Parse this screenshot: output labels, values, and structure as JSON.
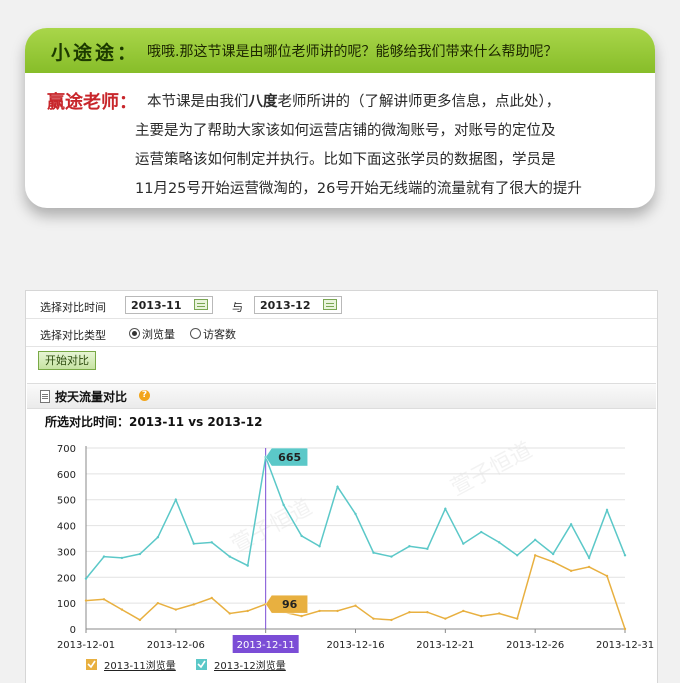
{
  "dialog": {
    "q_name": "小途途：",
    "q_text": "哦哦.那这节课是由哪位老师讲的呢？能够给我们带来什么帮助呢？",
    "a_name": "赢途老师：",
    "a_line1_pre": "本节课是由我们",
    "a_line1_bold": "八度",
    "a_line1_post": "老师所讲的（了解讲师更多信息，点此处），",
    "a_line2": "主要是为了帮助大家该如何运营店铺的微淘账号，对账号的定位及",
    "a_line3": "运营策略该如何制定并执行。比如下面这张学员的数据图，学员是",
    "a_line4": "11月25号开始运营微淘的，26号开始无线端的流量就有了很大的提升"
  },
  "filters": {
    "period_label": "选择对比时间",
    "date1": "2013-11",
    "with_label": "与",
    "date2": "2013-12",
    "type_label": "选择对比类型",
    "option_views": "浏览量",
    "option_visitors": "访客数",
    "start_button": "开始对比"
  },
  "section": {
    "title": "按天流量对比",
    "help": "?",
    "period": "所选对比时间：2013-11 vs 2013-12"
  },
  "chart_data": {
    "type": "line",
    "title": "所选对比时间：2013-11 vs 2013-12",
    "y_ticks": [
      "0",
      "100",
      "200",
      "300",
      "400",
      "500",
      "600",
      "700"
    ],
    "ylim": [
      0,
      700
    ],
    "x_labels": [
      "2013-12-01",
      "2013-12-06",
      "2013-12-11",
      "2013-12-16",
      "2013-12-21",
      "2013-12-26",
      "2013-12-31"
    ],
    "highlight_label": "2013-12-11",
    "grid": true,
    "legend_position": "bottom-left",
    "series": [
      {
        "name": "2013-11浏览量",
        "color": "#e8b040",
        "values": [
          110,
          115,
          75,
          35,
          100,
          75,
          95,
          120,
          60,
          70,
          96,
          65,
          50,
          70,
          70,
          90,
          40,
          35,
          65,
          65,
          40,
          70,
          50,
          60,
          40,
          285,
          260,
          225,
          240,
          205,
          0
        ],
        "tooltip_index": 10,
        "tooltip_value": "96"
      },
      {
        "name": "2013-12浏览量",
        "color": "#5bc8c8",
        "values": [
          195,
          280,
          275,
          290,
          355,
          500,
          330,
          335,
          280,
          245,
          665,
          480,
          360,
          320,
          550,
          445,
          295,
          280,
          320,
          310,
          465,
          330,
          375,
          335,
          285,
          345,
          290,
          405,
          275,
          460,
          285
        ],
        "tooltip_index": 10,
        "tooltip_value": "665"
      }
    ]
  },
  "watermark": "萱子恒道"
}
